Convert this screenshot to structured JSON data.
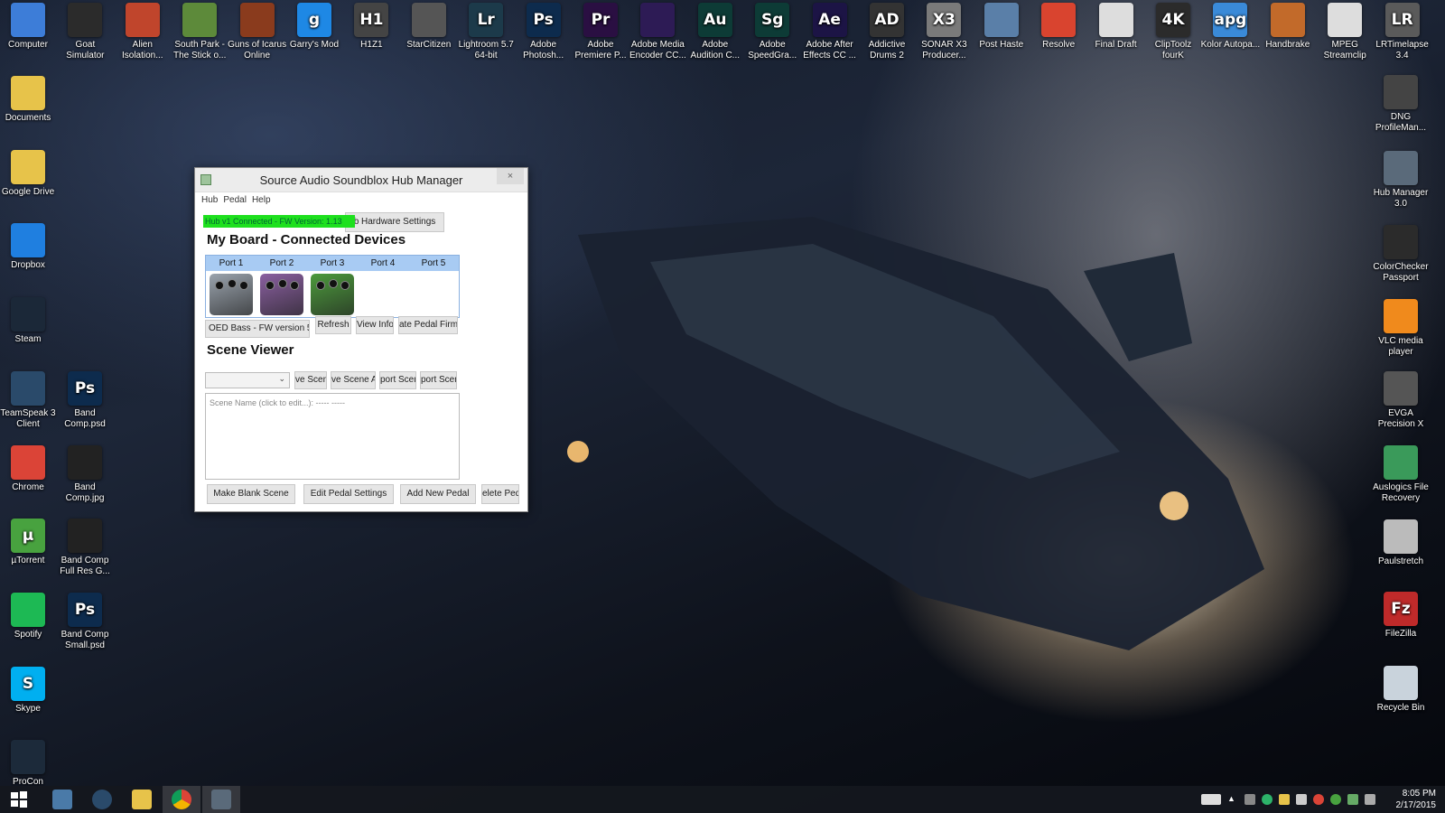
{
  "desktop": {
    "top_icons": [
      {
        "label": "Computer",
        "glyph": "",
        "color": "#3d7dd8",
        "icon": "computer-icon"
      },
      {
        "label": "Goat Simulator",
        "glyph": "",
        "color": "#2b2b2b",
        "icon": "goat-icon"
      },
      {
        "label": "Alien Isolation...",
        "glyph": "",
        "color": "#c0452c",
        "icon": "alien-icon"
      },
      {
        "label": "South Park - The Stick o...",
        "glyph": "",
        "color": "#5d8a3a",
        "icon": "south-park-icon"
      },
      {
        "label": "Guns of Icarus Online",
        "glyph": "",
        "color": "#8a3b1d",
        "icon": "crosshair-icon"
      },
      {
        "label": "Garry's Mod",
        "glyph": "g",
        "color": "#1e88e5",
        "icon": "garrys-mod-icon"
      },
      {
        "label": "H1Z1",
        "glyph": "H1",
        "color": "#444444",
        "icon": "h1z1-icon"
      },
      {
        "label": "StarCitizen",
        "glyph": "",
        "color": "#555555",
        "icon": "star-citizen-icon"
      },
      {
        "label": "Lightroom 5.7 64-bit",
        "glyph": "Lr",
        "color": "#1c3a4a",
        "icon": "lightroom-icon"
      },
      {
        "label": "Adobe Photosh...",
        "glyph": "Ps",
        "color": "#0d2b4d",
        "icon": "photoshop-icon"
      },
      {
        "label": "Adobe Premiere P...",
        "glyph": "Pr",
        "color": "#2a0f42",
        "icon": "premiere-icon"
      },
      {
        "label": "Adobe Media Encoder CC...",
        "glyph": "",
        "color": "#2d1b55",
        "icon": "media-encoder-icon"
      },
      {
        "label": "Adobe Audition C...",
        "glyph": "Au",
        "color": "#0d3b36",
        "icon": "audition-icon"
      },
      {
        "label": "Adobe SpeedGra...",
        "glyph": "Sg",
        "color": "#0d3b36",
        "icon": "speedgrade-icon"
      },
      {
        "label": "Adobe After Effects CC ...",
        "glyph": "Ae",
        "color": "#1c1445",
        "icon": "after-effects-icon"
      },
      {
        "label": "Addictive Drums 2",
        "glyph": "AD",
        "color": "#333333",
        "icon": "addictive-drums-icon"
      },
      {
        "label": "SONAR X3 Producer...",
        "glyph": "X3",
        "color": "#7a7a7a",
        "icon": "sonar-icon"
      },
      {
        "label": "Post Haste",
        "glyph": "",
        "color": "#5a7fa8",
        "icon": "post-haste-icon"
      },
      {
        "label": "Resolve",
        "glyph": "",
        "color": "#d9442f",
        "icon": "resolve-icon"
      },
      {
        "label": "Final Draft",
        "glyph": "",
        "color": "#dddddd",
        "icon": "final-draft-icon"
      },
      {
        "label": "ClipToolz fourK",
        "glyph": "4K",
        "color": "#2b2b2b",
        "icon": "cliptoolz-icon"
      },
      {
        "label": "Kolor Autopa...",
        "glyph": "apg",
        "color": "#3a8ad8",
        "icon": "autopano-icon"
      },
      {
        "label": "Handbrake",
        "glyph": "",
        "color": "#c26a2a",
        "icon": "handbrake-icon"
      },
      {
        "label": "MPEG Streamclip",
        "glyph": "",
        "color": "#dddddd",
        "icon": "clapper-icon"
      },
      {
        "label": "LRTimelapse 3.4",
        "glyph": "LR",
        "color": "#5a5a5a",
        "icon": "lrtimelapse-icon"
      }
    ],
    "left_icons": [
      {
        "label": "Documents",
        "glyph": "",
        "color": "#e7c34a",
        "icon": "folder-icon"
      },
      {
        "label": "Google Drive",
        "glyph": "",
        "color": "#e7c34a",
        "icon": "google-drive-icon"
      },
      {
        "label": "Dropbox",
        "glyph": "",
        "color": "#1f7fe0",
        "icon": "dropbox-icon"
      },
      {
        "label": "Steam",
        "glyph": "",
        "color": "#1b2838",
        "icon": "steam-icon"
      },
      {
        "label": "TeamSpeak 3 Client",
        "glyph": "",
        "color": "#2a4a6a",
        "icon": "teamspeak-icon"
      },
      {
        "label": "Chrome",
        "glyph": "",
        "color": "#db4437",
        "icon": "chrome-icon"
      },
      {
        "label": "µTorrent",
        "glyph": "µ",
        "color": "#48a23f",
        "icon": "utorrent-icon"
      },
      {
        "label": "Spotify",
        "glyph": "",
        "color": "#1db954",
        "icon": "spotify-icon"
      },
      {
        "label": "Skype",
        "glyph": "S",
        "color": "#00aff0",
        "icon": "skype-icon"
      },
      {
        "label": "ProCon",
        "glyph": "",
        "color": "#1c2a3a",
        "icon": "procon-icon"
      }
    ],
    "second_col_icons": [
      {
        "label": "Band Comp.psd",
        "glyph": "Ps",
        "color": "#0d2b4d",
        "icon": "psd-file-icon"
      },
      {
        "label": "Band Comp.jpg",
        "glyph": "",
        "color": "#222222",
        "icon": "jpg-file-icon"
      },
      {
        "label": "Band Comp Full Res G...",
        "glyph": "",
        "color": "#222222",
        "icon": "jpg-file-icon"
      },
      {
        "label": "Band Comp Small.psd",
        "glyph": "Ps",
        "color": "#0d2b4d",
        "icon": "psd-file-icon"
      }
    ],
    "right_icons": [
      {
        "label": "DNG ProfileMan...",
        "glyph": "",
        "color": "#444444",
        "icon": "dng-icon"
      },
      {
        "label": "Hub Manager 3.0",
        "glyph": "",
        "color": "#5a6a7a",
        "icon": "hub-manager-icon"
      },
      {
        "label": "ColorChecker Passport",
        "glyph": "",
        "color": "#2b2b2b",
        "icon": "colorchecker-icon"
      },
      {
        "label": "VLC media player",
        "glyph": "",
        "color": "#f08a1c",
        "icon": "vlc-icon"
      },
      {
        "label": "EVGA Precision X",
        "glyph": "",
        "color": "#555555",
        "icon": "evga-icon"
      },
      {
        "label": "Auslogics File Recovery",
        "glyph": "",
        "color": "#3a9a5a",
        "icon": "auslogics-icon"
      },
      {
        "label": "Paulstretch",
        "glyph": "",
        "color": "#bbbbbb",
        "icon": "cd-icon"
      },
      {
        "label": "FileZilla",
        "glyph": "Fz",
        "color": "#bf2a2a",
        "icon": "filezilla-icon"
      },
      {
        "label": "Recycle Bin",
        "glyph": "",
        "color": "#c9d3dc",
        "icon": "recycle-bin-icon"
      }
    ]
  },
  "window": {
    "title": "Source Audio Soundblox Hub Manager",
    "close": "×",
    "menu": [
      "Hub",
      "Pedal",
      "Help"
    ],
    "status": "Hub v1 Connected - FW Version: 1.13",
    "hw_button": "b Hardware Settings",
    "board_heading": "My Board - Connected Devices",
    "ports": [
      "Port 1",
      "Port 2",
      "Port 3",
      "Port 4",
      "Port 5"
    ],
    "pedal_colors": [
      "#9aa3ad",
      "#8a5fa0",
      "#4c9a3c"
    ],
    "device_buttons": [
      "OED Bass - FW version 5",
      "Refresh",
      "View Info",
      "ate Pedal Firmw"
    ],
    "scene_heading": "Scene Viewer",
    "scene_buttons": [
      "ve Scen",
      "ve Scene A",
      "port Scen",
      "port Scen"
    ],
    "scene_placeholder": "Scene Name (click to edit...): ----- -----",
    "bottom_buttons": [
      "Make Blank Scene",
      "Edit Pedal Settings",
      "Add New Pedal",
      "elete Ped"
    ]
  },
  "taskbar": {
    "clock_time": "8:05 PM",
    "clock_date": "2/17/2015"
  }
}
